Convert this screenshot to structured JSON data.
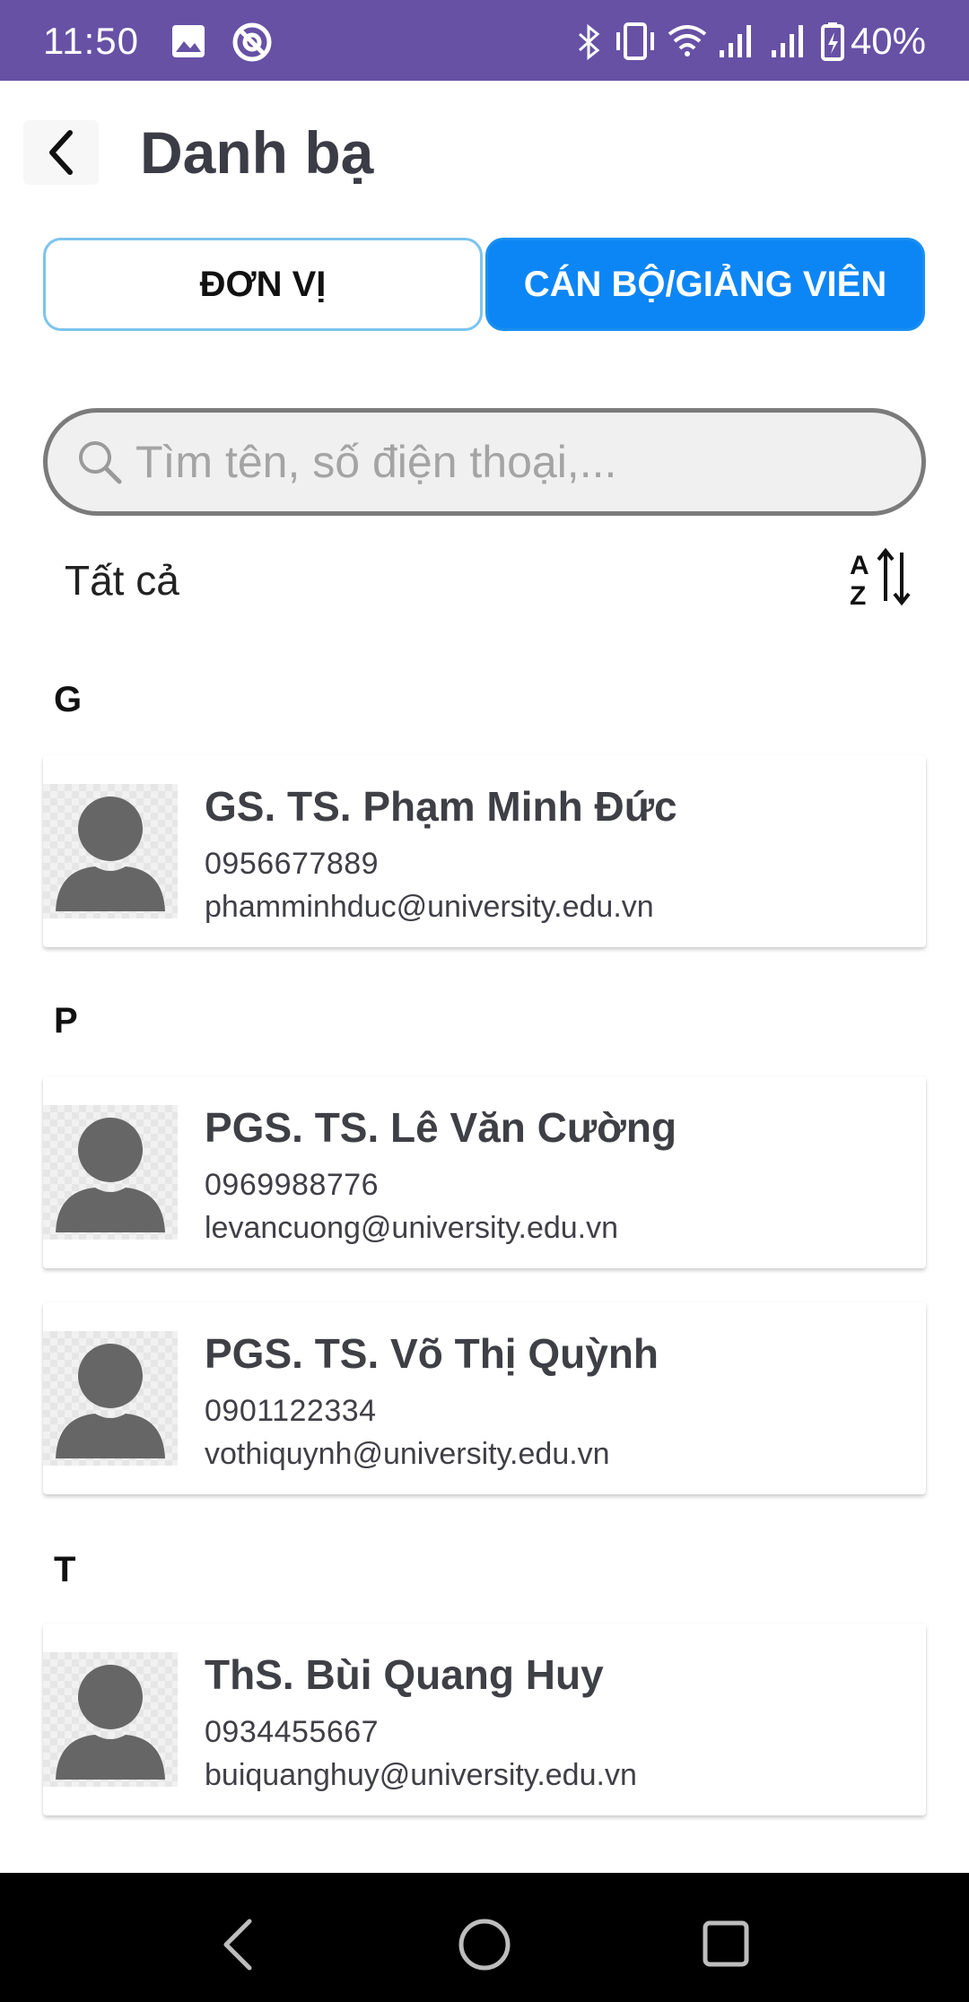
{
  "status_bar": {
    "time": "11:50",
    "battery": "40%",
    "background": "#6751a5"
  },
  "header": {
    "title": "Danh bạ",
    "back_icon": "chevron-left-icon"
  },
  "tabs": [
    {
      "label": "ĐƠN VỊ",
      "selected": false
    },
    {
      "label": "CÁN BỘ/GIẢNG VIÊN",
      "selected": true
    }
  ],
  "search": {
    "placeholder": "Tìm tên, số điện thoại,...",
    "value": ""
  },
  "filter": {
    "label": "Tất cả",
    "sort_icon": "sort-az-icon"
  },
  "sections": [
    {
      "letter": "G",
      "contacts": [
        {
          "name": "GS. TS. Phạm Minh Đức",
          "phone": "0956677889",
          "email": "phamminhduc@university.edu.vn"
        }
      ]
    },
    {
      "letter": "P",
      "contacts": [
        {
          "name": "PGS. TS. Lê Văn Cường",
          "phone": "0969988776",
          "email": "levancuong@university.edu.vn"
        },
        {
          "name": "PGS. TS. Võ Thị Quỳnh",
          "phone": "0901122334",
          "email": "vothiquynh@university.edu.vn"
        }
      ]
    },
    {
      "letter": "T",
      "contacts": [
        {
          "name": "ThS. Bùi Quang Huy",
          "phone": "0934455667",
          "email": "buiquanghuy@university.edu.vn"
        }
      ]
    }
  ],
  "colors": {
    "accent": "#0d86f5",
    "tab_border": "#7cc4ee",
    "text": "#3f3f46"
  }
}
